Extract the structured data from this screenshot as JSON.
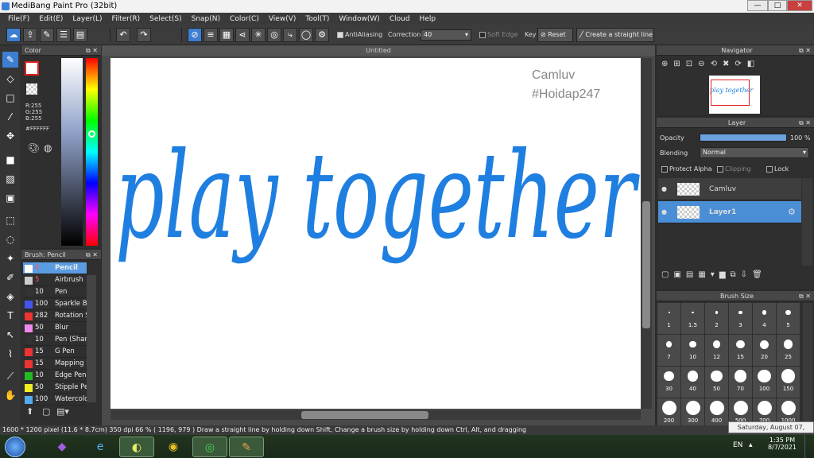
{
  "window": {
    "title": "MediBang Paint Pro (32bit)",
    "minimize": "—",
    "maximize": "□",
    "close": "✕"
  },
  "menu": [
    "File(F)",
    "Edit(E)",
    "Layer(L)",
    "Filter(R)",
    "Select(S)",
    "Snap(N)",
    "Color(C)",
    "View(V)",
    "Tool(T)",
    "Window(W)",
    "Cloud",
    "Help"
  ],
  "toolbar": {
    "antialiasing_label": "AntiAliasing",
    "correction_label": "Correction",
    "correction_value": "40",
    "soft_edge_label": "Soft Edge",
    "key_label": "Key",
    "reset_label": "Reset",
    "straight_line_label": "Create a straight line"
  },
  "color_panel": {
    "title": "Color",
    "r": "R:255",
    "g": "G:255",
    "b": "B:255",
    "hex": "#FFFFFF"
  },
  "brush_panel": {
    "title": "Brush: Pencil",
    "items": [
      {
        "size": "4",
        "name": "Pencil",
        "color": "#ffffff",
        "selected": true
      },
      {
        "size": "5",
        "name": "Airbrush",
        "color": "#cccccc"
      },
      {
        "size": "10",
        "name": "Pen",
        "color": "#333333"
      },
      {
        "size": "100",
        "name": "Sparkle Br",
        "color": "#4455ee"
      },
      {
        "size": "282",
        "name": "Rotation S",
        "color": "#ee3333"
      },
      {
        "size": "50",
        "name": "Blur",
        "color": "#ee88ee"
      },
      {
        "size": "10",
        "name": "Pen (Shar",
        "color": "#333333"
      },
      {
        "size": "15",
        "name": "G Pen",
        "color": "#ee3333"
      },
      {
        "size": "15",
        "name": "Mapping P",
        "color": "#ee3333"
      },
      {
        "size": "10",
        "name": "Edge Pen",
        "color": "#22bb22"
      },
      {
        "size": "50",
        "name": "Stipple Pe",
        "color": "#eeee22"
      },
      {
        "size": "100",
        "name": "Watercolo",
        "color": "#55aaee"
      }
    ]
  },
  "document": {
    "tab_title": "Untitled",
    "artwork_text": "play together",
    "watermark_line1": "Camluv",
    "watermark_line2": "#Hoidap247"
  },
  "navigator": {
    "title": "Navigator",
    "thumb_text": "play together"
  },
  "layer_panel": {
    "title": "Layer",
    "opacity_label": "Opacity",
    "opacity_value": "100 %",
    "opacity_fraction": 1.0,
    "blending_label": "Blending",
    "blending_value": "Normal",
    "protect_alpha": "Protect Alpha",
    "clipping": "Clipping",
    "lock": "Lock",
    "layers": [
      {
        "name": "Camluv",
        "selected": false
      },
      {
        "name": "Layer1",
        "selected": true
      }
    ]
  },
  "brush_size": {
    "title": "Brush Size",
    "sizes": [
      "1",
      "1.5",
      "2",
      "3",
      "4",
      "5",
      "7",
      "10",
      "12",
      "15",
      "20",
      "25",
      "30",
      "40",
      "50",
      "70",
      "100",
      "150",
      "200",
      "300",
      "400",
      "500",
      "700",
      "1000"
    ]
  },
  "status": {
    "text": "1600 * 1200 pixel   (11.6 * 8.7cm)   350 dpi   66 %   ( 1196, 979 )   Draw a straight line by holding down Shift, Change a brush size by holding down Ctrl, Alt, and dragging"
  },
  "tooltip": "Saturday, August 07, 2021",
  "taskbar": {
    "lang": "EN",
    "time": "1:35 PM",
    "date": "8/7/2021"
  },
  "colors": {
    "accent": "#3d7ed1",
    "ink": "#1f7fe0"
  }
}
